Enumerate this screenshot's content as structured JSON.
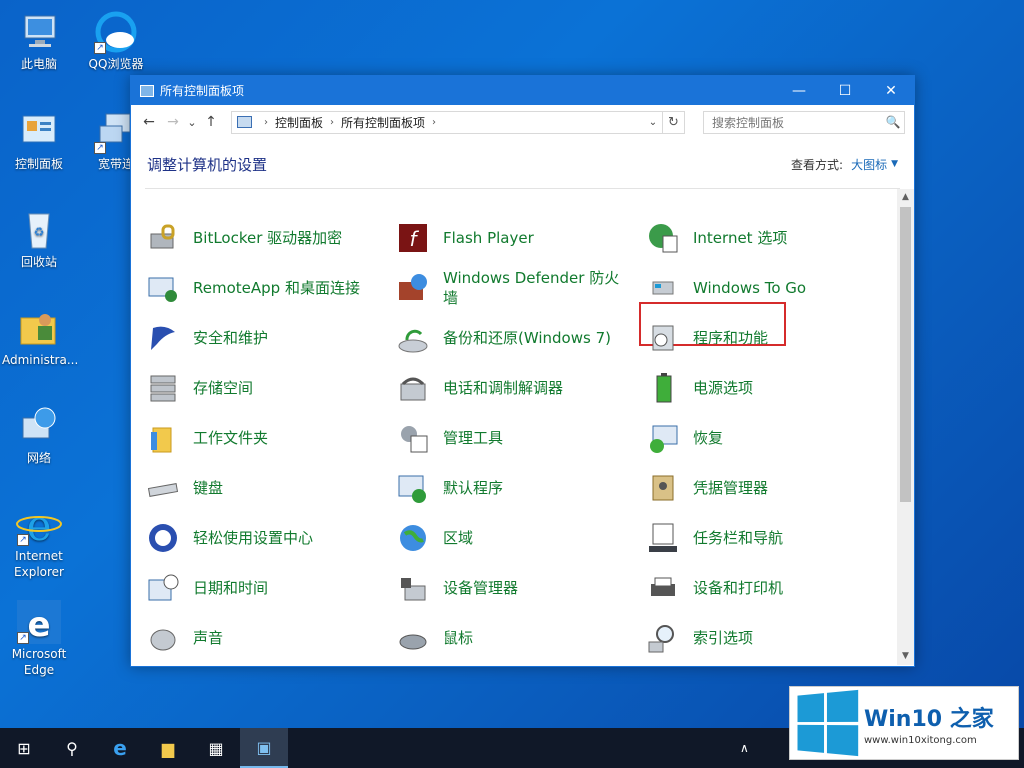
{
  "desktop": {
    "icons": [
      {
        "label": "此电脑"
      },
      {
        "label": "QQ浏览器"
      },
      {
        "label": "控制面板"
      },
      {
        "label": "宽带连"
      },
      {
        "label": "回收站"
      },
      {
        "label": "Administra..."
      },
      {
        "label": "网络"
      },
      {
        "label": "Internet Explorer"
      },
      {
        "label": "Microsoft Edge"
      }
    ]
  },
  "window": {
    "title": "所有控制面板项",
    "minimize": "—",
    "maximize": "☐",
    "close": "✕",
    "nav": {
      "back": "←",
      "forward": "→",
      "recent": "⌄",
      "up": "↑",
      "breadcrumb": [
        "控制面板",
        "所有控制面板项"
      ],
      "dropdown": "⌄",
      "refresh": "↻",
      "search_placeholder": "搜索控制面板",
      "search_icon": "🔍"
    },
    "header": {
      "heading": "调整计算机的设置",
      "view_label": "查看方式:",
      "view_value": "大图标",
      "view_caret": "▼"
    },
    "items": [
      [
        "BitLocker 驱动器加密",
        "Flash Player",
        "Internet 选项"
      ],
      [
        "RemoteApp 和桌面连接",
        "Windows Defender 防火墙",
        "Windows To Go"
      ],
      [
        "安全和维护",
        "备份和还原(Windows 7)",
        "程序和功能"
      ],
      [
        "存储空间",
        "电话和调制解调器",
        "电源选项"
      ],
      [
        "工作文件夹",
        "管理工具",
        "恢复"
      ],
      [
        "键盘",
        "默认程序",
        "凭据管理器"
      ],
      [
        "轻松使用设置中心",
        "区域",
        "任务栏和导航"
      ],
      [
        "日期和时间",
        "设备管理器",
        "设备和打印机"
      ],
      [
        "声音",
        "鼠标",
        "索引选项"
      ]
    ],
    "highlighted_item": "程序和功能",
    "scroll": {
      "up": "▲",
      "down": "▼"
    }
  },
  "taskbar": {
    "start": "⊞",
    "search": "⚲",
    "edge": "e",
    "explorer": "▆",
    "store": "▦",
    "control_panel": "▣",
    "tray_chevron": "∧"
  },
  "watermark": {
    "brand": "Win10 之家",
    "url": "www.win10xitong.com"
  }
}
